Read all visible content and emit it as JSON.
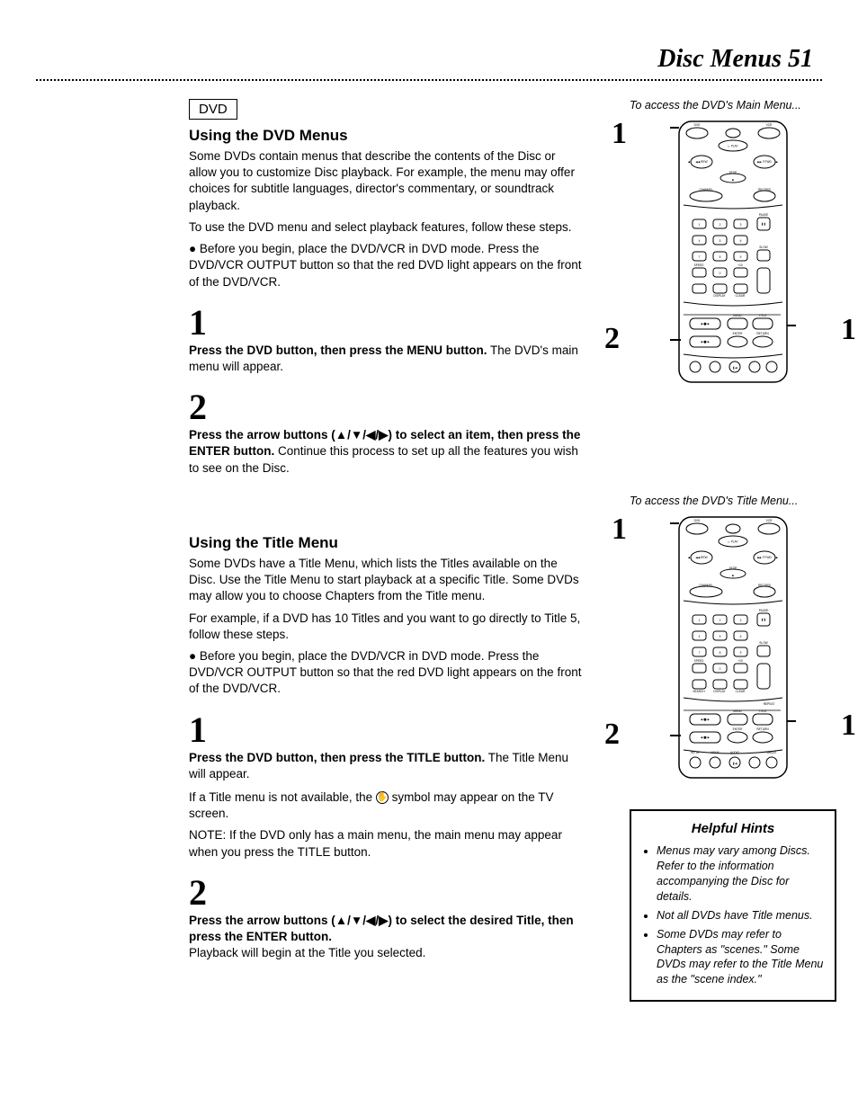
{
  "header": {
    "title": "Disc Menus 51"
  },
  "box_label": "DVD",
  "section1": {
    "heading": "Using the DVD Menus",
    "p1": "Some DVDs contain menus that describe the contents of the Disc or allow you to customize Disc playback. For example, the menu may offer choices for subtitle languages, director's commentary, or soundtrack playback.",
    "p2": "To use the DVD menu and select playback features, follow these steps.",
    "bullet": "Before you begin, place the DVD/VCR in DVD mode. Press the DVD/VCR OUTPUT button so that the red DVD light appears on the front of the DVD/VCR.",
    "step1_num": "1",
    "step1_b": "Press the DVD button, then press the MENU button.",
    "step1_rest": " The DVD's main menu will appear.",
    "step2_num": "2",
    "step2_b1": "Press the arrow buttons (",
    "step2_arrows": "▲/▼/◀/▶",
    "step2_b2": ") to select an item, then press the ENTER button.",
    "step2_rest": " Continue this process to set up all the features you wish to see on the Disc."
  },
  "section2": {
    "heading": "Using the Title Menu",
    "p1": "Some DVDs have a Title Menu, which lists the Titles available on the Disc. Use the Title Menu to start playback at a specific Title. Some DVDs may allow you to choose Chapters from the Title menu.",
    "p2": "For example, if a DVD has 10 Titles and you want to go directly to Title 5, follow these steps.",
    "bullet": "Before you begin, place the DVD/VCR in DVD mode. Press the DVD/VCR OUTPUT button so that the red DVD light appears on the front of the DVD/VCR.",
    "step1_num": "1",
    "step1_b": "Press the DVD button, then press the TITLE button.",
    "step1_rest": " The Title Menu will appear.",
    "note1a": "If a Title menu is not available, the ",
    "note1b": " symbol may appear on the TV screen.",
    "note2": "NOTE: If the DVD only has a main menu, the main menu may appear when you press the TITLE button.",
    "step2_num": "2",
    "step2_b1": "Press the arrow buttons (",
    "step2_arrows": "▲/▼/◀/▶",
    "step2_b2": ") to select the desired Title, then press the ENTER button.",
    "step2_rest": "Playback will begin at the Title you selected."
  },
  "right": {
    "caption1": "To access the DVD's Main Menu...",
    "caption2": "To access the DVD's Title Menu...",
    "num1": "1",
    "num2": "2"
  },
  "hints": {
    "title": "Helpful Hints",
    "items": [
      "Menus may vary among Discs. Refer to the information accompanying the Disc for details.",
      "Not all DVDs have Title menus.",
      "Some DVDs may refer to Chapters as \"scenes.\" Some DVDs may refer to the Title Menu as the \"scene index.\""
    ]
  }
}
